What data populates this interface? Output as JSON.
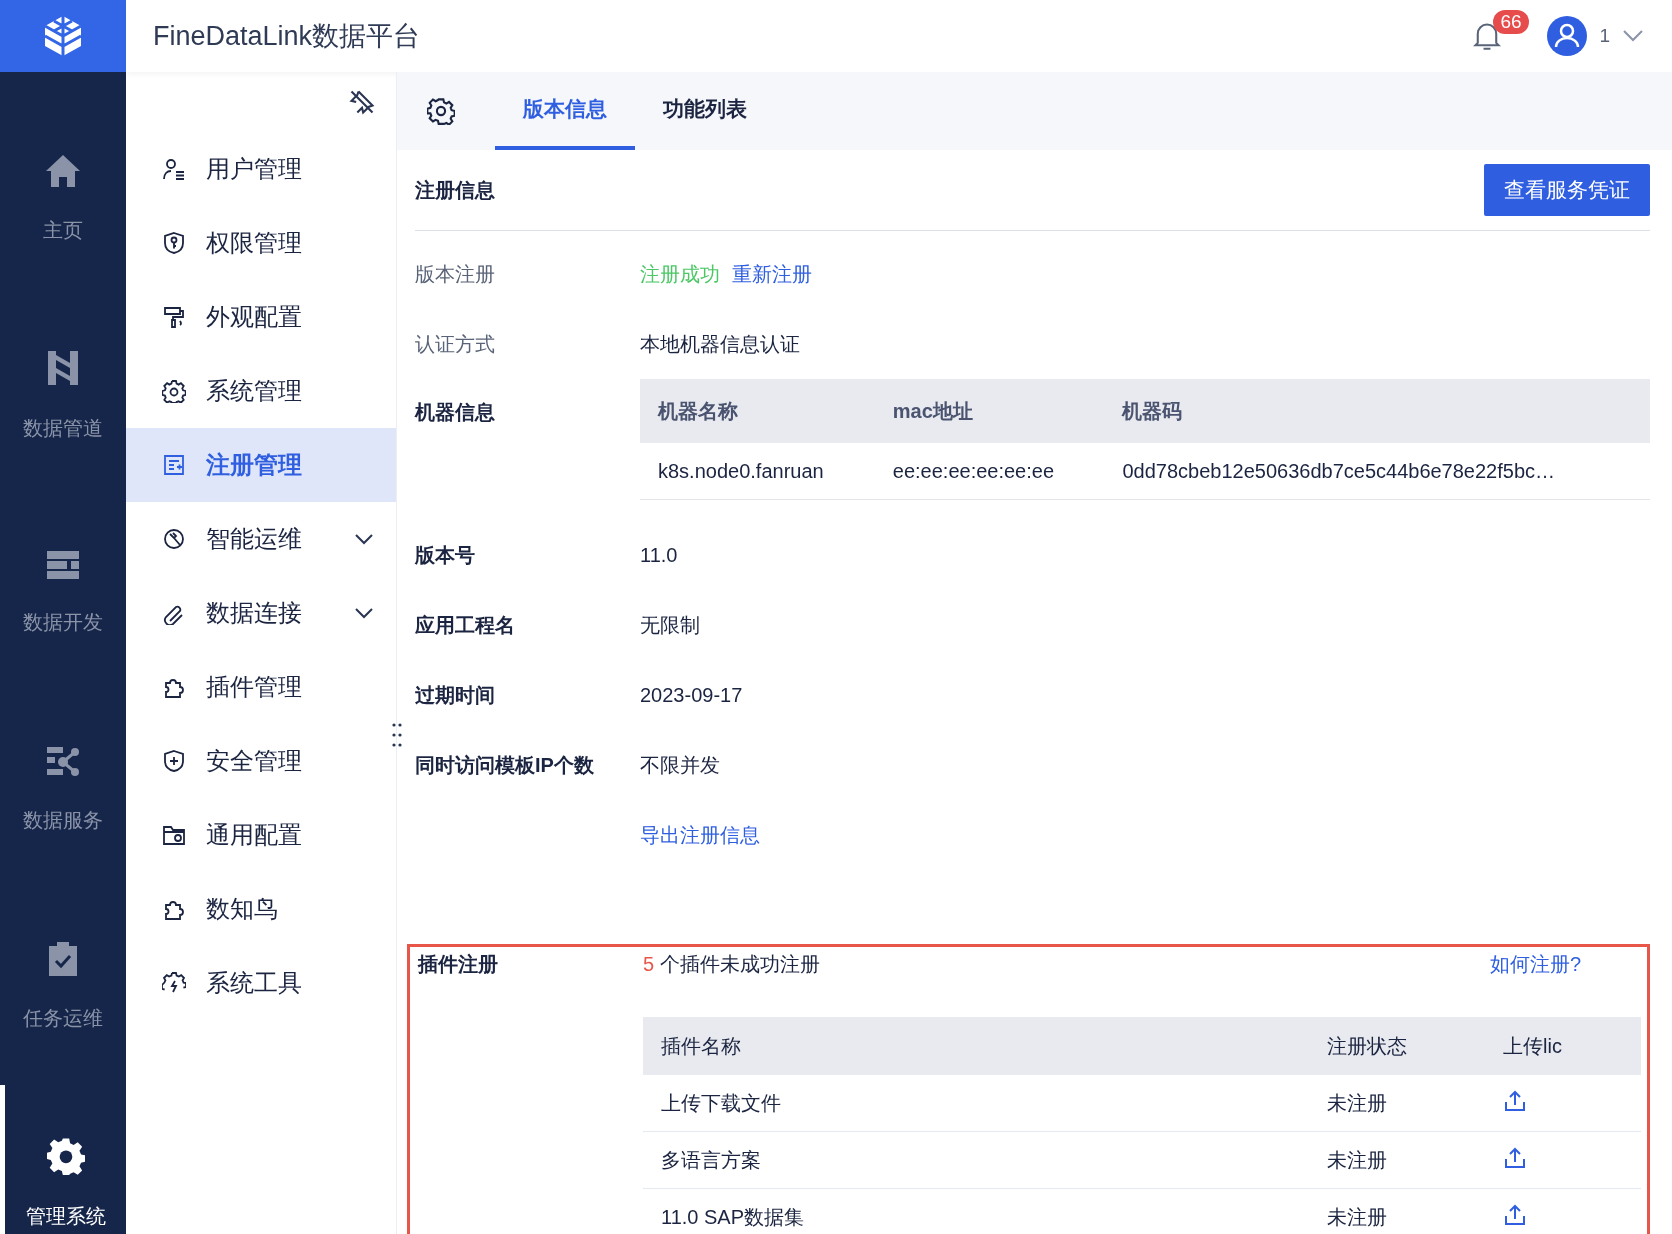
{
  "app": {
    "title": "FineDataLink数据平台"
  },
  "header": {
    "notification_count": "66",
    "user_name": "1"
  },
  "nav_rail": [
    {
      "label": "主页",
      "selected": false
    },
    {
      "label": "数据管道",
      "selected": false
    },
    {
      "label": "数据开发",
      "selected": false
    },
    {
      "label": "数据服务",
      "selected": false
    },
    {
      "label": "任务运维",
      "selected": false
    },
    {
      "label": "管理系统",
      "selected": true
    }
  ],
  "sidebar": {
    "items": [
      {
        "label": "用户管理",
        "selected": false,
        "expandable": false
      },
      {
        "label": "权限管理",
        "selected": false,
        "expandable": false
      },
      {
        "label": "外观配置",
        "selected": false,
        "expandable": false
      },
      {
        "label": "系统管理",
        "selected": false,
        "expandable": false
      },
      {
        "label": "注册管理",
        "selected": true,
        "expandable": false
      },
      {
        "label": "智能运维",
        "selected": false,
        "expandable": true
      },
      {
        "label": "数据连接",
        "selected": false,
        "expandable": true
      },
      {
        "label": "插件管理",
        "selected": false,
        "expandable": false
      },
      {
        "label": "安全管理",
        "selected": false,
        "expandable": false
      },
      {
        "label": "通用配置",
        "selected": false,
        "expandable": false
      },
      {
        "label": "数知鸟",
        "selected": false,
        "expandable": false
      },
      {
        "label": "系统工具",
        "selected": false,
        "expandable": false
      }
    ]
  },
  "tabs": [
    {
      "label": "版本信息",
      "selected": true
    },
    {
      "label": "功能列表",
      "selected": false
    }
  ],
  "section": {
    "title": "注册信息",
    "button": "查看服务凭证"
  },
  "fields": [
    {
      "kind": "status",
      "label": "版本注册",
      "emphasis": false,
      "status": "注册成功",
      "link": "重新注册"
    },
    {
      "kind": "text",
      "label": "认证方式",
      "emphasis": false,
      "value": "本地机器信息认证"
    },
    {
      "kind": "table",
      "label": "机器信息",
      "emphasis": true,
      "columns": [
        "机器名称",
        "mac地址",
        "机器码"
      ],
      "rows": [
        [
          "k8s.node0.fanruan",
          "ee:ee:ee:ee:ee:ee",
          "0dd78cbeb12e50636db7ce5c44b6e78e22f5bc…"
        ]
      ]
    },
    {
      "kind": "text",
      "label": "版本号",
      "emphasis": true,
      "value": "11.0"
    },
    {
      "kind": "text",
      "label": "应用工程名",
      "emphasis": true,
      "value": "无限制"
    },
    {
      "kind": "text",
      "label": "过期时间",
      "emphasis": true,
      "value": "2023-09-17"
    },
    {
      "kind": "text",
      "label": "同时访问模板IP个数",
      "emphasis": true,
      "value": "不限并发"
    },
    {
      "kind": "link",
      "value": "导出注册信息"
    }
  ],
  "plugins": {
    "label": "插件注册",
    "count": "5",
    "summary": "个插件未成功注册",
    "help_link": "如何注册?",
    "highlighted": true,
    "columns": [
      "插件名称",
      "注册状态",
      "上传lic"
    ],
    "rows": [
      {
        "name": "上传下载文件",
        "status": "未注册"
      },
      {
        "name": "多语言方案",
        "status": "未注册"
      },
      {
        "name": "11.0 SAP数据集",
        "status": "未注册"
      }
    ]
  }
}
